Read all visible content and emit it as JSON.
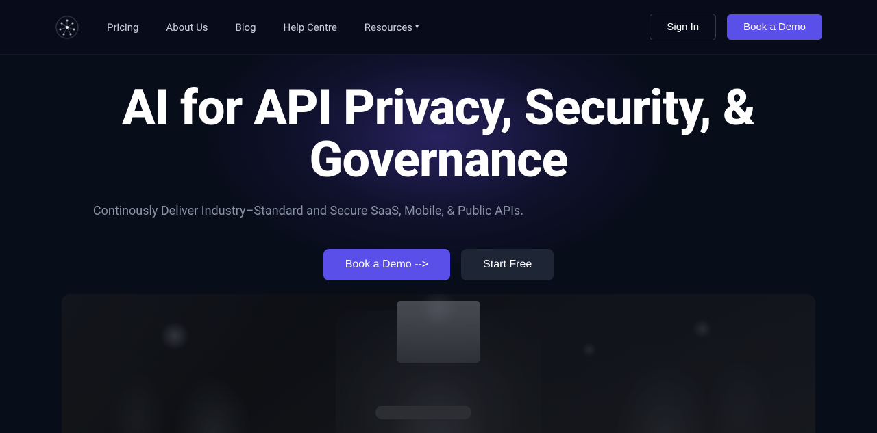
{
  "navbar": {
    "logo_alt": "Company Logo",
    "links": [
      {
        "label": "Pricing",
        "id": "pricing"
      },
      {
        "label": "About Us",
        "id": "about-us"
      },
      {
        "label": "Blog",
        "id": "blog"
      },
      {
        "label": "Help Centre",
        "id": "help-centre"
      },
      {
        "label": "Resources",
        "id": "resources",
        "has_dropdown": true
      }
    ],
    "sign_in_label": "Sign In",
    "book_demo_label": "Book a Demo"
  },
  "hero": {
    "title": "AI for API Privacy, Security, & Governance",
    "subtitle": "Continously Deliver Industry–Standard and Secure SaaS, Mobile, & Public APIs.",
    "book_demo_label": "Book a Demo -->",
    "start_free_label": "Start Free"
  }
}
